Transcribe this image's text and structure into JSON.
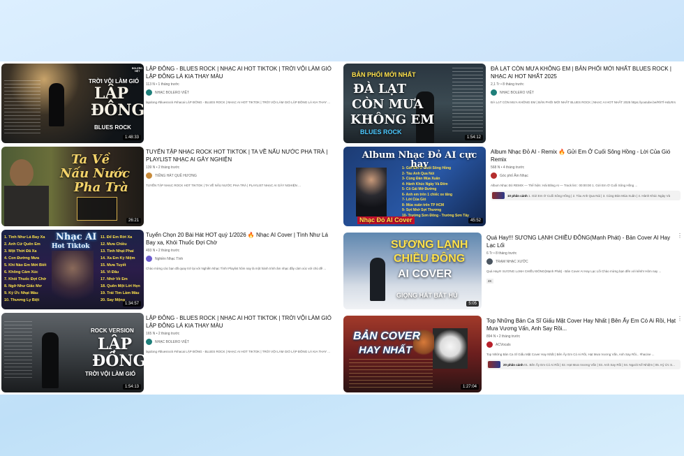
{
  "left": [
    {
      "thumb": {
        "line1": "TRỜI VỘI LÀM GIÓ",
        "line2": "LẬP",
        "line3": "ĐÔNG",
        "line4": "BLUES ROCK",
        "duration": "1:48:33",
        "brand": "BOLERO VIỆT"
      },
      "title": "LẬP ĐÔNG - BLUES ROCK | NHẠC AI HOT TIKTOK | TRỜI VỘI LÀM GIÓ LẬP ĐÔNG LÁ KIA THAY MÀU",
      "stats": "113 N • 1 tháng trước",
      "channel": "NHẠC BOLERO VIỆT",
      "desc": "lapdong #bluesrock #nhacai LẬP ĐÔNG - BLUES ROCK | NHẠC AI HOT TIKTOK | TRỜI VỘI LÀM GIÓ LẬP ĐÔNG LÁ KIA THAY ..."
    },
    {
      "thumb": {
        "line1": "Ta Về",
        "line2": "Nấu Nước",
        "line3": "Pha Trà",
        "duration": "26:21"
      },
      "title": "TUYỂN TẬP NHẠC ROCK HOT TIKTOK | TA VỀ NẤU NƯỚC PHA TRÀ | PLAYLIST NHẠC AI GÂY NGHIỆN",
      "stats": "139 N • 2 tháng trước",
      "channel": "TIẾNG HÁT QUÊ HƯƠNG",
      "desc": "TUYỂN TẬP NHẠC ROCK HOT TIKTOK | TA VỀ NẤU NƯỚC PHA TRÀ | PLAYLIST NHẠC AI GÂY NGHIỆN ..."
    },
    {
      "thumb": {
        "line1": "Nhạc AI",
        "line2": "Hot Tiktok",
        "duration": "1:34:57",
        "tracks_left": [
          "1. Tình Như Lá Bay Xa",
          "2. Anh Cứ Quên Em",
          "3. Một Thời Đã Xa",
          "4. Con Đường Mưa",
          "5. Khi Nào Em Mới Biết",
          "6. Không Cảm Xúc",
          "7. Khói Thuốc Đợi Chờ",
          "8. Ngỡ Như Giấc Mơ",
          "9. Ký Ức Nhạt Màu",
          "10. Thương Ly Biệt"
        ],
        "tracks_right": [
          "11. Để Em Rời Xa",
          "12. Mưa Chiều",
          "13. Tình Nhạt Phai",
          "14. Xa Em Kỷ Niệm",
          "15. Mưa Tuyết",
          "16. Vì Đâu",
          "17. Nhớ Về Em",
          "18. Quên Một Lời Hẹn",
          "19. Trái Tim Lầm Màu",
          "20. Say Mộng"
        ]
      },
      "title": "Tuyển Chọn 20 Bài Hát HOT quý 1/2026 🔥 Nhạc AI Cover | Tình Như Lá Bay xa, Khói Thuốc Đợi Chờ",
      "stats": "493 N • 2 tháng trước",
      "channel": "Nghiền Nhạc Tình",
      "desc": "Chào mừng các bạn đã quay trở lại với Nghiền Nhạc Tình! Playlist hôm nay là một hành trình âm nhạc đầy cảm xúc với chủ đề ..."
    },
    {
      "thumb": {
        "line1": "ROCK VERSION",
        "line2": "LẬP",
        "line3": "ĐÔNG",
        "line4": "TRỜI VỘI LÀM GIÓ",
        "duration": "1:54:13"
      },
      "title": "LẬP ĐÔNG - BLUES ROCK | NHẠC AI HOT TIKTOK | TRỜI VỘI LÀM GIÓ LẬP ĐÔNG LÁ KIA THAY MÀU",
      "stats": "165 N • 2 tháng trước",
      "channel": "NHẠC BOLERO VIỆT",
      "desc": "lapdong #bluesrock #nhacai LẬP ĐÔNG - BLUES ROCK | NHẠC AI HOT TIKTOK | TRỜI VỘI LÀM GIÓ LẬP ĐÔNG LÁ KIA THAY ..."
    }
  ],
  "right": [
    {
      "thumb": {
        "line1": "BẢN PHỐI MỚI NHẤT",
        "line2": "ĐÀ LẠT",
        "line3": "CÒN MƯA",
        "line4": "KHÔNG EM",
        "line5": "BLUES ROCK",
        "duration": "1:54:12"
      },
      "title": "ĐÀ LẠT CÒN MƯA KHÔNG EM | BẢN PHỐI MỚI NHẤT BLUES ROCK | NHẠC AI HOT NHẤT 2025",
      "stats": "2,1 Tr • 8 tháng trước",
      "channel": "NHẠC BOLERO VIỆT",
      "desc": "ĐÀ LẠT CÒN MƯA KHÔNG EM | BẢN PHỐI MỚI NHẤT BLUES ROCK | NHẠC AI HOT NHẤT 2025 https://youtube.be/RhTf-HdLRrs"
    },
    {
      "thumb": {
        "line1": "Album Nhạc Đỏ AI cực hay",
        "line2": "Nhạc Đỏ AI Cover",
        "duration": "45:52",
        "tracks": [
          "1- Gửi Em Ở Cuối Sông Hồng",
          "2- Tàu Anh Qua Núi",
          "3- Cùng Đàn Mùa Xuân",
          "4- Hành Khúc Ngày Và Đêm",
          "5- Cô Gái Mở Đường",
          "6- Anh em trên 1 chiếc xe tăng",
          "7- Lời Của Gió",
          "8- Mùa xuân trên TP HCM",
          "9- Sợi Nhớ Sợi Thương",
          "10- Trường Sơn Đông - Trường Sơn Tây"
        ]
      },
      "title": "Album Nhạc Đỏ AI - Remix 🔥 Gửi Em Ở Cuối Sông Hồng - Lời Của Gió Remix",
      "stats": "568 N • 4 tháng trước",
      "channel": "Góc phố Âm Nhạc",
      "desc": "Album Nhạc Đỏ REMIX — Thể hiện: Hải Đăng AI — Track list : 00:00:00 1. Gửi Em Ở Cuối Sông Hồng ...",
      "chapters_label": "10 phân cảnh",
      "chapters": "1. Gửi Em Ở Cuối Sông Hồng | 2. Tàu Anh Qua Núi | 3. Cùng Đàn Mùa Xuân | 4. Hành Khúc Ngày Và"
    },
    {
      "thumb": {
        "line1": "SƯƠNG LẠNH",
        "line2": "CHIỀU ĐÔNG",
        "line3": "AI COVER",
        "line4": "GIỌNG HÁT BẤT HỦ",
        "duration": "5:05"
      },
      "title": "Quá Hay!!! SƯƠNG LẠNH CHIỀU ĐÔNG(Mạnh Phát) - Bản Cover AI Hay Lạc Lối",
      "stats": "6 Tr • 8 tháng trước",
      "channel": "TRẠM NHẠC XƯỚC",
      "desc": "Quá Hay!!! SƯƠNG LẠNH CHIỀU ĐÔNG(Mạnh Phát) - Bản Cover AI Hay Lạc Lối Chào mừng bạn đến với kênh! Hôm nay ...",
      "badge": "4K"
    },
    {
      "thumb": {
        "line1": "BẢN COVER",
        "line2": "HAY NHẤT",
        "duration": "1:27:04"
      },
      "title": "Top Những Bản Ca Sĩ Giấu Mặt Cover Hay Nhất | Bên Ấy Em Có Ai Rồi, Hạt Mưa Vương Vấn, Anh Say Rồi...",
      "stats": "894 N • 2 tháng trước",
      "channel": "ACVocals",
      "desc": "Top Những Bản Ca Sĩ Giấu Mặt Cover Hay Nhất | Bên Ấy Em Có Ai Rồi, Hạt Mưa Vương Vấn, Anh Say Rồi... #hacine ...",
      "chapters_label": "20 phân cảnh",
      "chapters": "01. Bên Ấy Em Có Ai Rồi | 02. Hạt Mưa Vương Vấn | 03. Anh Say Rồi | 04. Người Kế Nhiệm | 05. Ký Ức S..."
    }
  ],
  "colors": {
    "title": "#0f0f0f",
    "meta": "#606060",
    "bg": "#ffffff"
  }
}
